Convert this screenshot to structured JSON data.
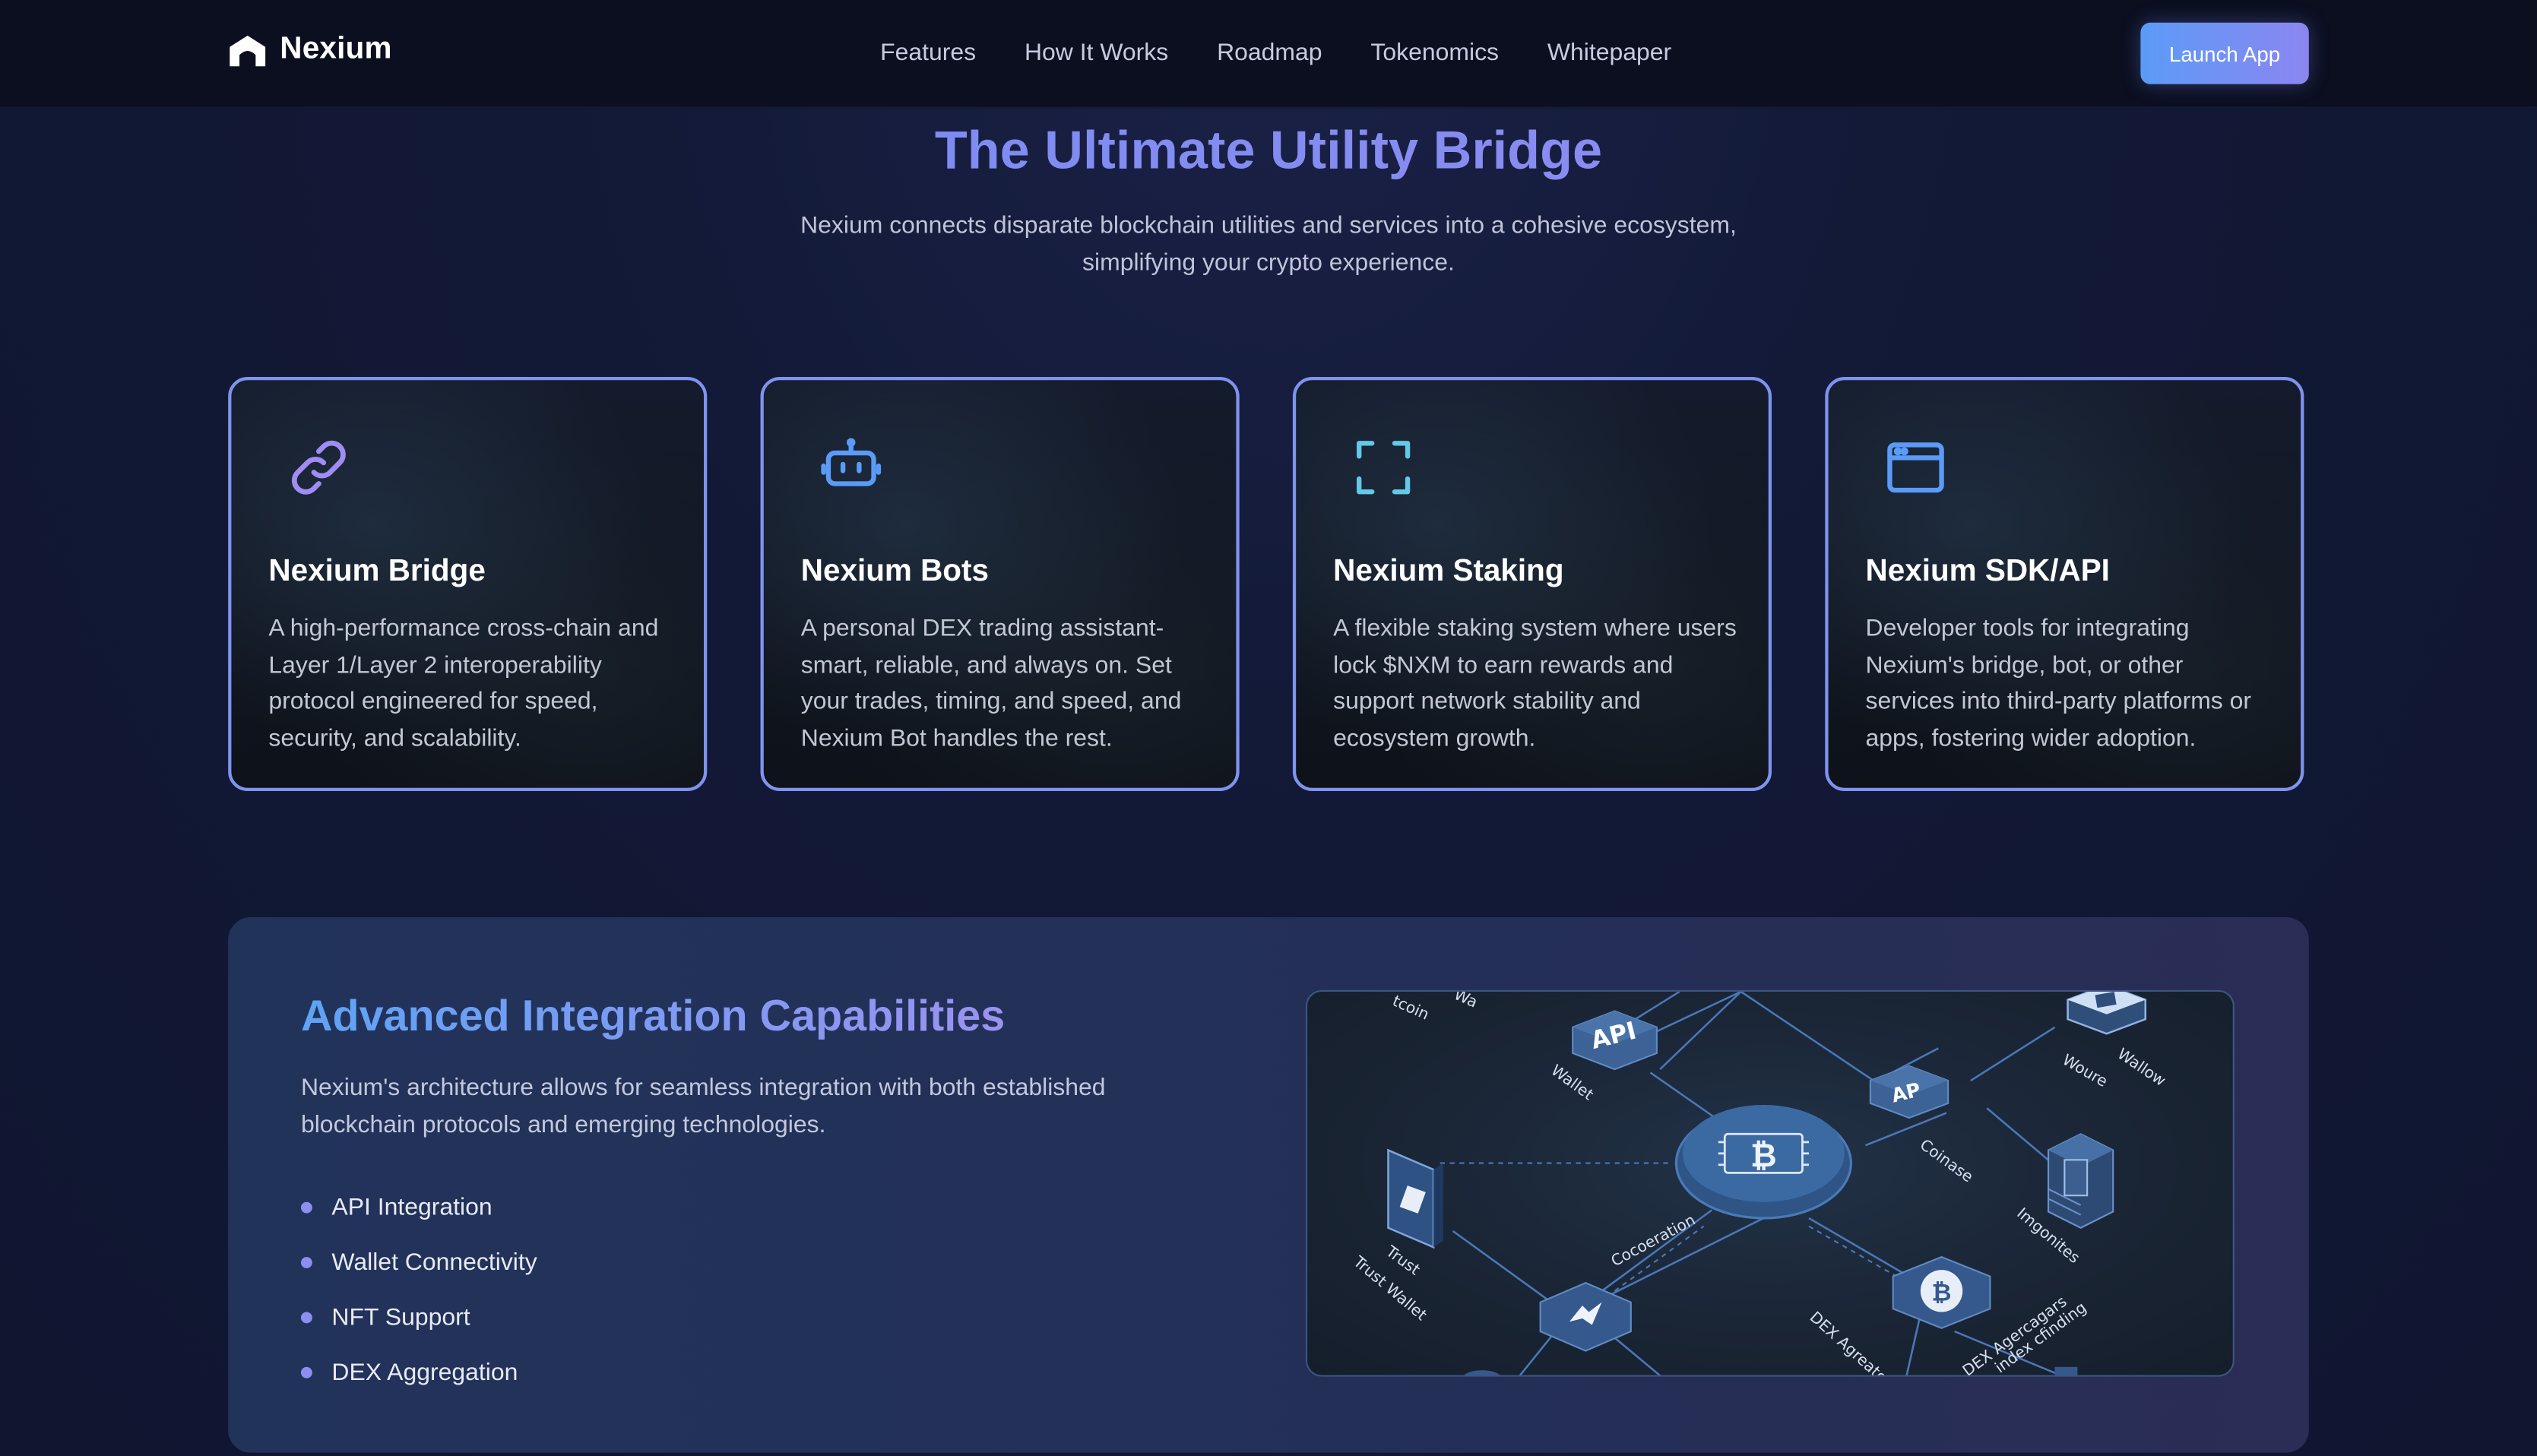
{
  "brand": {
    "name": "Nexium",
    "logo_icon": "house-arch-logo-icon"
  },
  "nav": {
    "links": [
      "Features",
      "How It Works",
      "Roadmap",
      "Tokenomics",
      "Whitepaper"
    ],
    "cta_label": "Launch App"
  },
  "hero": {
    "title": "The Ultimate Utility Bridge",
    "subtitle": "Nexium connects disparate blockchain utilities and services into a cohesive ecosystem, simplifying your crypto experience."
  },
  "features": [
    {
      "icon": "chain-link-icon",
      "title": "Nexium Bridge",
      "description": "A high-performance cross-chain and Layer 1/Layer 2 interoperability protocol engineered for speed, security, and scalability."
    },
    {
      "icon": "robot-icon",
      "title": "Nexium Bots",
      "description": "A personal DEX trading assistant-smart, reliable, and always on. Set your trades, timing, and speed, and Nexium Bot handles the rest."
    },
    {
      "icon": "expand-corners-icon",
      "title": "Nexium Staking",
      "description": "A flexible staking system where users lock $NXM to earn rewards and support network stability and ecosystem growth."
    },
    {
      "icon": "browser-window-icon",
      "title": "Nexium SDK/API",
      "description": "Developer tools for integrating Nexium's bridge, bot, or other services into third-party platforms or apps, fostering wider adoption."
    }
  ],
  "integration": {
    "title": "Advanced Integration Capabilities",
    "description": "Nexium's architecture allows for seamless integration with both established blockchain protocols and emerging technologies.",
    "items": [
      "API Integration",
      "Wallet Connectivity",
      "NFT Support",
      "DEX Aggregation"
    ],
    "diagram": {
      "labels": {
        "api_node": "API",
        "ap_node": "AP",
        "top_left_a": "tcoin",
        "top_left_b": "Wa",
        "wallet": "Wallet",
        "coinase": "Coinase",
        "trust": "Trust",
        "trust_wallet": "Trust Wallet",
        "cocoeration": "Cocoeration",
        "woure": "Woure",
        "wallow": "Wallow",
        "imgonites": "Imgonites",
        "dex_agreators": "DEX Agreators",
        "dex_agercagars": "DEX Agercagars",
        "index_cfinding": "index cfinding"
      }
    }
  },
  "colors": {
    "background": "#101630",
    "header": "#0b0f20",
    "card_border": "#7f93ee",
    "accent_blue": "#5b9bf7",
    "accent_purple": "#8b86f0",
    "bullet": "#8d8ff0",
    "icon_purple": "#a08cf2",
    "icon_blue": "#5b9bf7",
    "icon_teal": "#64c8e6"
  }
}
